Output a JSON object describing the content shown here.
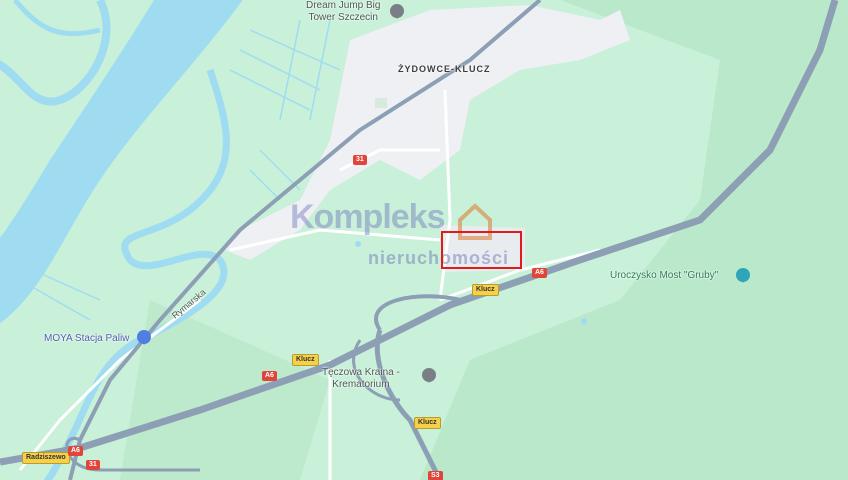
{
  "map": {
    "colors": {
      "land": "#c9f0d8",
      "water": "#9fdcf2",
      "highway": "#8c9fb4",
      "urban": "#eef0f3",
      "selection": "#e01b1b"
    },
    "labels": {
      "place": "ŻYDOWCE-KLUCZ",
      "poi_dream": "Dream Jump Big\nTower Szczecin",
      "park": "Uroczysko Most \"Gruby\"",
      "fuel": "MOYA Stacja Paliw",
      "krematorium": "Tęczowa Kraina -\nKrematorium",
      "street": "Rymarska"
    },
    "shields": {
      "r31_top": "31",
      "a6_right": "A6",
      "klucz_mid": "Klucz",
      "klucz_left": "Klucz",
      "a6_mid": "A6",
      "klucz_bottom": "Klucz",
      "radziszewo": "Radziszewo",
      "a6_left": "A6",
      "r31_bottom": "31",
      "s3": "S3"
    },
    "watermark": {
      "line1": "Kompleks",
      "line2": "nieruchomości"
    },
    "icons": {
      "dream_pin": "location-pin-icon",
      "park_pin": "park-pin-icon",
      "fuel_pin": "fuel-pin-icon",
      "krem_pin": "location-pin-icon"
    }
  }
}
